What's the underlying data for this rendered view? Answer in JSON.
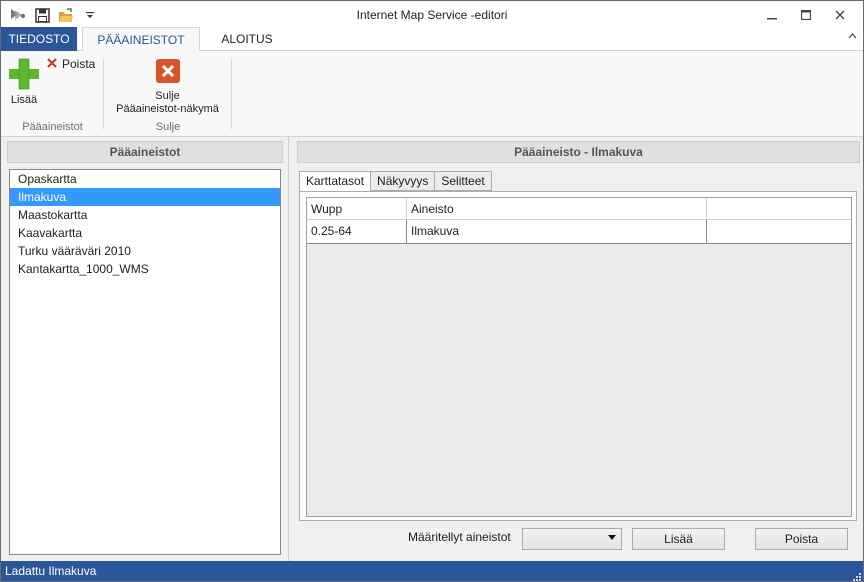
{
  "window": {
    "title": "Internet Map Service -editori",
    "minimize": "—",
    "maximize": "□",
    "close": "✕"
  },
  "ribbon": {
    "tabs": {
      "file": "TIEDOSTO",
      "active": "PÄÄAINEISTOT",
      "start": "ALOITUS"
    },
    "groups": {
      "paaaineistot": {
        "label": "Pääaineistot",
        "add_label": "Lisää",
        "remove_label": "Poista"
      },
      "sulje": {
        "label": "Sulje",
        "close_line1": "Sulje",
        "close_line2": "Pääaineistot-näkymä"
      }
    }
  },
  "left_panel": {
    "header": "Pääaineistot",
    "items": [
      "Opaskartta",
      "Ilmakuva",
      "Maastokartta",
      "Kaavakartta",
      "Turku vääräväri 2010",
      "Kantakartta_1000_WMS"
    ],
    "selected_index": 1
  },
  "right_panel": {
    "header": "Pääaineisto - Ilmakuva",
    "tabs": [
      "Karttatasot",
      "Näkyvyys",
      "Selitteet"
    ],
    "active_tab": 0,
    "grid": {
      "columns": [
        "Wupp",
        "Aineisto",
        ""
      ],
      "rows": [
        [
          "0.25-64",
          "Ilmakuva",
          ""
        ]
      ]
    },
    "footer": {
      "label": "Määritellyt aineistot",
      "combo_value": "",
      "add_button": "Lisää",
      "remove_button": "Poista"
    }
  },
  "status": {
    "text": "Ladattu Ilmakuva"
  },
  "colors": {
    "accent": "#2b579a",
    "selection": "#3399ff",
    "add_icon": "#5cb82e",
    "close_icon": "#d9542c"
  }
}
